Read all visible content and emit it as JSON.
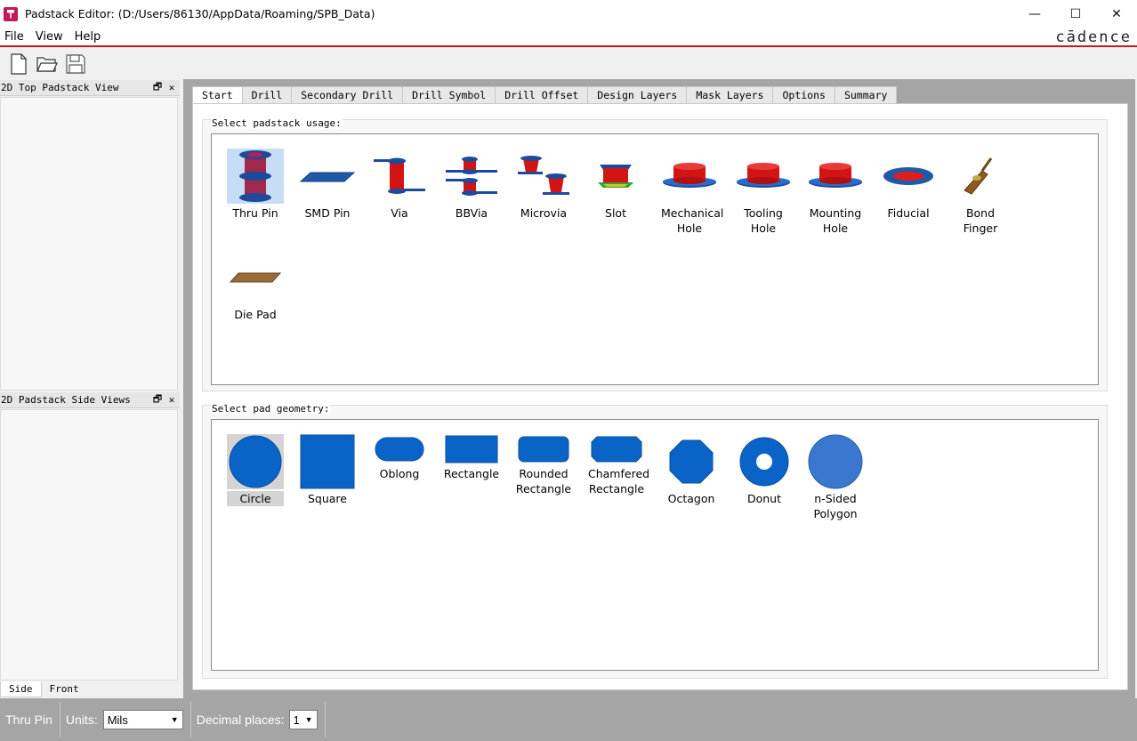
{
  "window": {
    "title": "Padstack Editor:  (D:/Users/86130/AppData/Roaming/SPB_Data)",
    "minimize": "—",
    "maximize": "☐",
    "close": "✕"
  },
  "menu": {
    "file": "File",
    "view": "View",
    "help": "Help",
    "brand": "cādence"
  },
  "toolbar": {
    "icons": [
      "new-file-icon",
      "open-folder-icon",
      "save-icon"
    ]
  },
  "left_panel": {
    "top_title": "2D Top Padstack View",
    "side_title": "2D Padstack Side Views",
    "float_glyph": "🗗",
    "close_glyph": "✕",
    "tabs": [
      "Side",
      "Front"
    ],
    "active_tab": "Side"
  },
  "tabs": [
    "Start",
    "Drill",
    "Secondary Drill",
    "Drill Symbol",
    "Drill Offset",
    "Design Layers",
    "Mask Layers",
    "Options",
    "Summary"
  ],
  "active_tab": "Start",
  "usage": {
    "label": "Select padstack usage:",
    "items": [
      {
        "label": "Thru Pin",
        "icon": "thru-pin-icon"
      },
      {
        "label": "SMD Pin",
        "icon": "smd-pin-icon"
      },
      {
        "label": "Via",
        "icon": "via-icon"
      },
      {
        "label": "BBVia",
        "icon": "bbvia-icon"
      },
      {
        "label": "Microvia",
        "icon": "microvia-icon"
      },
      {
        "label": "Slot",
        "icon": "slot-icon"
      },
      {
        "label": "Mechanical\nHole",
        "icon": "mechanical-hole-icon"
      },
      {
        "label": "Tooling\nHole",
        "icon": "tooling-hole-icon"
      },
      {
        "label": "Mounting\nHole",
        "icon": "mounting-hole-icon"
      },
      {
        "label": "Fiducial",
        "icon": "fiducial-icon"
      },
      {
        "label": "Bond\nFinger",
        "icon": "bond-finger-icon"
      },
      {
        "label": "Die Pad",
        "icon": "die-pad-icon"
      }
    ],
    "selected": "Thru Pin"
  },
  "geometry": {
    "label": "Select pad geometry:",
    "items": [
      {
        "label": "Circle",
        "icon": "circle-icon"
      },
      {
        "label": "Square",
        "icon": "square-icon"
      },
      {
        "label": "Oblong",
        "icon": "oblong-icon"
      },
      {
        "label": "Rectangle",
        "icon": "rectangle-icon"
      },
      {
        "label": "Rounded\nRectangle",
        "icon": "rounded-rectangle-icon"
      },
      {
        "label": "Chamfered\nRectangle",
        "icon": "chamfered-rectangle-icon"
      },
      {
        "label": "Octagon",
        "icon": "octagon-icon"
      },
      {
        "label": "Donut",
        "icon": "donut-icon"
      },
      {
        "label": "n-Sided\nPolygon",
        "icon": "n-sided-polygon-icon"
      }
    ],
    "selected": "Circle"
  },
  "status": {
    "usage": "Thru Pin",
    "units_label": "Units:",
    "units_value": "Mils",
    "decimal_label": "Decimal places:",
    "decimal_value": "1"
  },
  "colors": {
    "accent_red": "#c21d1d",
    "pad_blue": "#0a64c8",
    "copper_red": "#d21414",
    "select_blue": "#c7dcf5"
  }
}
